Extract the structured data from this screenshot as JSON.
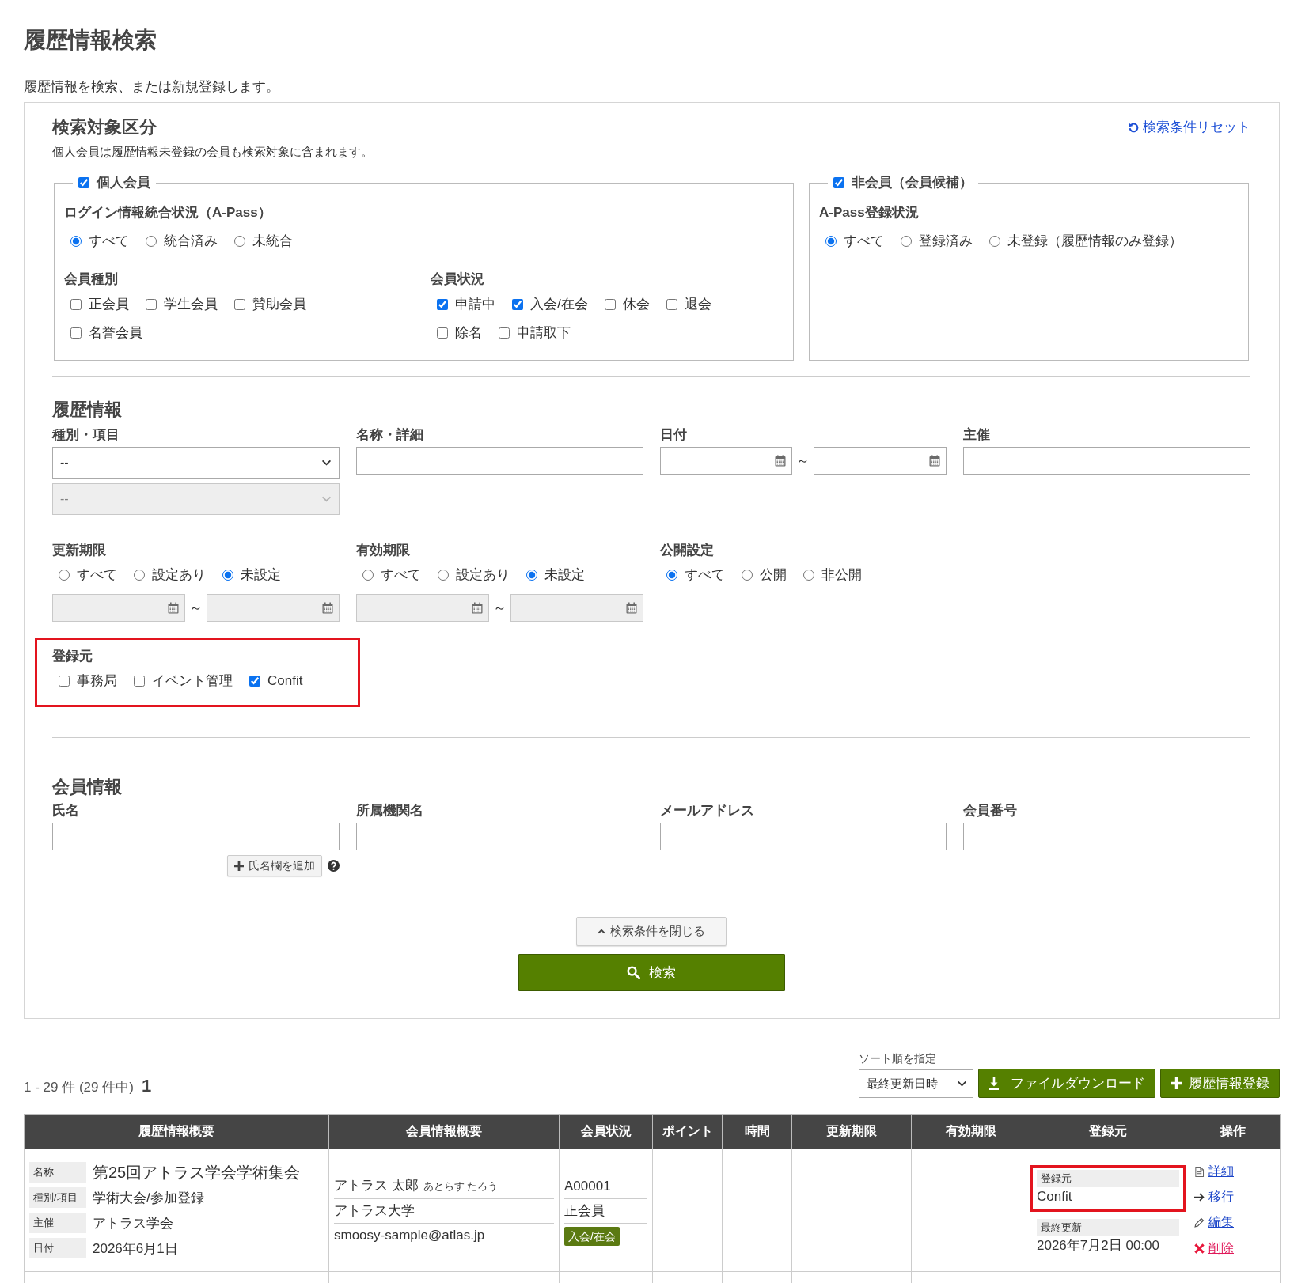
{
  "page": {
    "title": "履歴情報検索",
    "description": "履歴情報を検索、または新規登録します。"
  },
  "search_panel": {
    "target": {
      "heading": "検索対象区分",
      "note": "個人会員は履歴情報未登録の会員も検索対象に含まれます。",
      "reset_link": "検索条件リセット",
      "groups": [
        {
          "label": "個人会員",
          "checked": true,
          "sections": [
            {
              "kind": "radio",
              "label": "ログイン情報統合状況（A-Pass）",
              "options": [
                {
                  "label": "すべて",
                  "selected": true
                },
                {
                  "label": "統合済み",
                  "selected": false
                },
                {
                  "label": "未統合",
                  "selected": false
                }
              ]
            },
            {
              "kind": "checkbox",
              "label": "会員種別",
              "options": [
                {
                  "label": "正会員",
                  "checked": false
                },
                {
                  "label": "学生会員",
                  "checked": false
                },
                {
                  "label": "賛助会員",
                  "checked": false
                },
                {
                  "label": "名誉会員",
                  "checked": false
                }
              ]
            },
            {
              "kind": "checkbox",
              "label": "会員状況",
              "options": [
                {
                  "label": "申請中",
                  "checked": true
                },
                {
                  "label": "入会/在会",
                  "checked": true
                },
                {
                  "label": "休会",
                  "checked": false
                },
                {
                  "label": "退会",
                  "checked": false
                },
                {
                  "label": "除名",
                  "checked": false
                },
                {
                  "label": "申請取下",
                  "checked": false
                }
              ]
            }
          ]
        },
        {
          "label": "非会員（会員候補）",
          "checked": true,
          "sections": [
            {
              "kind": "radio",
              "label": "A-Pass登録状況",
              "options": [
                {
                  "label": "すべて",
                  "selected": true
                },
                {
                  "label": "登録済み",
                  "selected": false
                },
                {
                  "label": "未登録（履歴情報のみ登録）",
                  "selected": false
                }
              ]
            }
          ]
        }
      ]
    },
    "history": {
      "heading": "履歴情報",
      "rows": [
        [
          {
            "kind": "select",
            "label": "種別・項目",
            "value": "--",
            "sub_select": {
              "value": "--",
              "disabled": true
            }
          },
          {
            "kind": "text",
            "label": "名称・詳細"
          },
          {
            "kind": "date_range",
            "label": "日付",
            "separator": "～",
            "disabled": false
          },
          {
            "kind": "text",
            "label": "主催"
          }
        ],
        [
          {
            "kind": "period",
            "label": "更新期限",
            "options": [
              {
                "label": "すべて",
                "selected": false
              },
              {
                "label": "設定あり",
                "selected": false
              },
              {
                "label": "未設定",
                "selected": true
              }
            ],
            "separator": "～",
            "disabled": true
          },
          {
            "kind": "period",
            "label": "有効期限",
            "options": [
              {
                "label": "すべて",
                "selected": false
              },
              {
                "label": "設定あり",
                "selected": false
              },
              {
                "label": "未設定",
                "selected": true
              }
            ],
            "separator": "～",
            "disabled": true
          },
          {
            "kind": "radio",
            "label": "公開設定",
            "options": [
              {
                "label": "すべて",
                "selected": true
              },
              {
                "label": "公開",
                "selected": false
              },
              {
                "label": "非公開",
                "selected": false
              }
            ]
          }
        ],
        [
          {
            "kind": "checkbox",
            "label": "登録元",
            "highlighted": true,
            "options": [
              {
                "label": "事務局",
                "checked": false
              },
              {
                "label": "イベント管理",
                "checked": false
              },
              {
                "label": "Confit",
                "checked": true
              }
            ]
          }
        ]
      ]
    },
    "member": {
      "heading": "会員情報",
      "fields": [
        {
          "label": "氏名",
          "add_button": "氏名欄を追加"
        },
        {
          "label": "所属機関名"
        },
        {
          "label": "メールアドレス"
        },
        {
          "label": "会員番号"
        }
      ]
    },
    "close_button": "検索条件を閉じる",
    "search_button": "検索"
  },
  "results": {
    "summary": "1 - 29 件 (29 件中)",
    "current_page": "1",
    "sort": {
      "label": "ソート順を指定",
      "value": "最終更新日時"
    },
    "download_button": "ファイルダウンロード",
    "register_button": "履歴情報登録",
    "table": {
      "columns": [
        {
          "kind": "history",
          "label": "履歴情報概要"
        },
        {
          "kind": "member",
          "label": "会員情報概要"
        },
        {
          "kind": "status",
          "label": "会員状況"
        },
        {
          "kind": "points",
          "label": "ポイント"
        },
        {
          "kind": "time",
          "label": "時間"
        },
        {
          "kind": "renewal",
          "label": "更新期限"
        },
        {
          "kind": "validity",
          "label": "有効期限"
        },
        {
          "kind": "source",
          "label": "登録元"
        },
        {
          "kind": "actions",
          "label": "操作"
        }
      ],
      "rows": [
        {
          "history": [
            {
              "label": "名称",
              "value": "第25回アトラス学会学術集会"
            },
            {
              "label": "種別/項目",
              "value": "学術大会/参加登録"
            },
            {
              "label": "主催",
              "value": "アトラス学会"
            },
            {
              "label": "日付",
              "value": "2026年6月1日"
            }
          ],
          "member": {
            "name": "アトラス 太郎",
            "kana": "あとらす たろう",
            "affiliation": "アトラス大学",
            "email": "smoosy-sample@atlas.jp"
          },
          "status": {
            "member_number": "A00001",
            "member_type": "正会員",
            "badge": "入会/在会"
          },
          "source": {
            "label": "登録元",
            "value": "Confit",
            "highlighted": true,
            "updated_label": "最終更新",
            "updated_value": "2026年7月2日 00:00"
          },
          "actions": [
            {
              "kind": "detail",
              "label": "詳細"
            },
            {
              "kind": "move",
              "label": "移行"
            },
            {
              "kind": "edit",
              "label": "編集"
            },
            {
              "kind": "delete",
              "label": "削除"
            }
          ]
        }
      ]
    }
  }
}
